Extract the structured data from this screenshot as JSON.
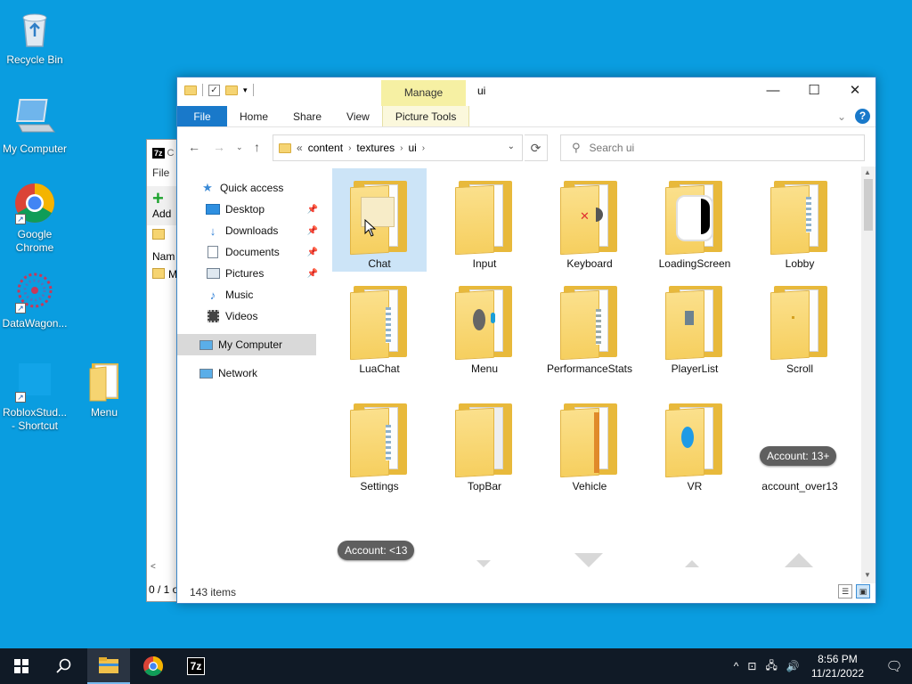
{
  "desktop": {
    "icons": [
      {
        "label": "Recycle Bin"
      },
      {
        "label": "My Computer"
      },
      {
        "label": "Google Chrome"
      },
      {
        "label": "DataWagon..."
      },
      {
        "label": "RobloxStud... - Shortcut"
      },
      {
        "label": "Menu"
      }
    ]
  },
  "zip_window": {
    "logo": "7z",
    "title_fragment": "C",
    "menu": "File",
    "add_label": "Add",
    "column": "Nam",
    "row": "M",
    "status": "0 / 1 o"
  },
  "explorer": {
    "title": "ui",
    "manage_tab": "Manage",
    "window_buttons": {
      "minimize": "—",
      "maximize": "☐",
      "close": "✕"
    },
    "ribbon_tabs": [
      "File",
      "Home",
      "Share",
      "View",
      "Picture Tools"
    ],
    "help": "?",
    "address": {
      "overflow": "«",
      "crumbs": [
        "content",
        "textures",
        "ui"
      ]
    },
    "search_placeholder": "Search ui",
    "nav_pane": [
      {
        "label": "Quick access",
        "icon": "star-icon"
      },
      {
        "label": "Desktop",
        "icon": "desktop-icon",
        "pinned": true
      },
      {
        "label": "Downloads",
        "icon": "download-icon",
        "pinned": true
      },
      {
        "label": "Documents",
        "icon": "document-icon",
        "pinned": true
      },
      {
        "label": "Pictures",
        "icon": "pictures-icon",
        "pinned": true
      },
      {
        "label": "Music",
        "icon": "music-icon"
      },
      {
        "label": "Videos",
        "icon": "video-icon"
      },
      {
        "label": "My Computer",
        "icon": "computer-icon",
        "selected": true
      },
      {
        "label": "Network",
        "icon": "network-icon"
      }
    ],
    "folders": [
      {
        "label": "Chat",
        "selected": true
      },
      {
        "label": "Input"
      },
      {
        "label": "Keyboard"
      },
      {
        "label": "LoadingScreen"
      },
      {
        "label": "Lobby"
      },
      {
        "label": "LuaChat"
      },
      {
        "label": "Menu"
      },
      {
        "label": "PerformanceStats"
      },
      {
        "label": "PlayerList"
      },
      {
        "label": "Scroll"
      },
      {
        "label": "Settings"
      },
      {
        "label": "TopBar"
      },
      {
        "label": "Vehicle"
      },
      {
        "label": "VR"
      }
    ],
    "image_file": {
      "label": "account_over13",
      "thumb_text": "Account: 13+"
    },
    "partial_thumb_text": "Account: <13",
    "status": {
      "items": "143 items"
    }
  },
  "taskbar": {
    "time": "8:56 PM",
    "date": "11/21/2022",
    "pinned": [
      "file-explorer-icon",
      "chrome-icon",
      "7zip-icon"
    ]
  },
  "colors": {
    "desktop": "#0a9de0",
    "accent": "#1979ca",
    "manage": "#f6f0a3",
    "selection": "#cce4f7",
    "taskbar": "#101a26"
  }
}
